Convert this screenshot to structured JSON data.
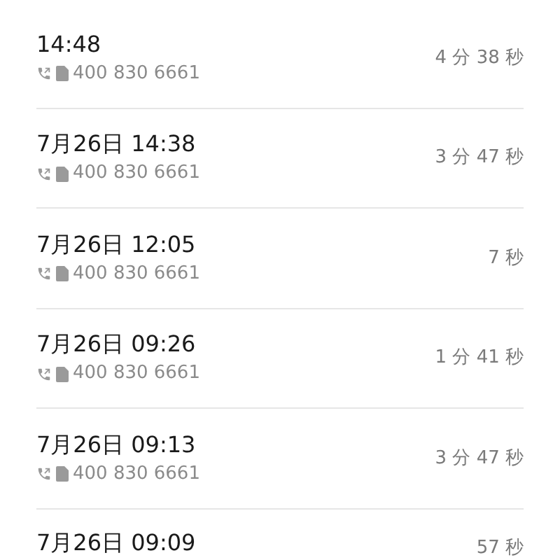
{
  "calls": [
    {
      "time": "14:48",
      "number": "400 830 6661",
      "duration": "4 分 38 秒"
    },
    {
      "time": "7月26日 14:38",
      "number": "400 830 6661",
      "duration": "3 分 47 秒"
    },
    {
      "time": "7月26日 12:05",
      "number": "400 830 6661",
      "duration": "7 秒"
    },
    {
      "time": "7月26日 09:26",
      "number": "400 830 6661",
      "duration": "1 分 41 秒"
    },
    {
      "time": "7月26日 09:13",
      "number": "400 830 6661",
      "duration": "3 分 47 秒"
    },
    {
      "time": "7月26日 09:09",
      "duration": "57 秒"
    }
  ]
}
